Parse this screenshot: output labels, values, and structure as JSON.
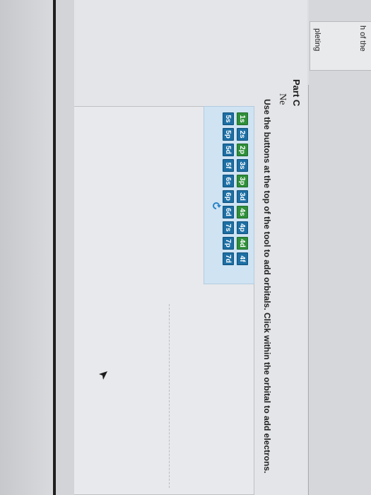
{
  "side_panel": {
    "text_line_1": "h of the",
    "text_line_2": "pleting"
  },
  "part": {
    "title": "Part C",
    "element": "Ne",
    "instructions": "Use the buttons at the top of the tool to add orbitals. Click within the orbital to add electrons."
  },
  "orbital_tool": {
    "row1": [
      "1s",
      "2s",
      "2p",
      "3s",
      "3p",
      "3d",
      "4s",
      "4p",
      "4d",
      "4f"
    ],
    "row2": [
      "5s",
      "5p",
      "5d",
      "5f",
      "6s",
      "6p",
      "6d",
      "7s",
      "7p",
      "7d"
    ],
    "reset_icon": "refresh-icon"
  },
  "colors": {
    "button_blue": "#1c6fa4",
    "button_green": "#2f8f3a",
    "toolbar_bg": "#cfe3f3"
  }
}
